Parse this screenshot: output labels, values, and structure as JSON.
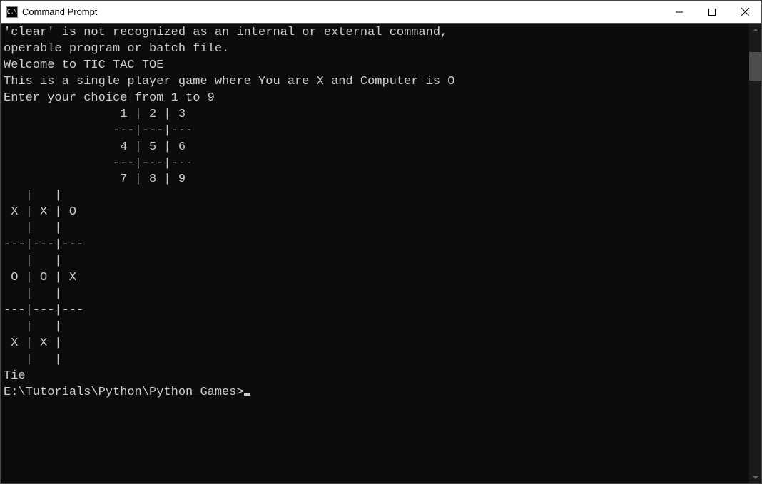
{
  "window": {
    "title": "Command Prompt",
    "icon_label": "C:\\"
  },
  "terminal": {
    "lines": {
      "l0": "'clear' is not recognized as an internal or external command,",
      "l1": "operable program or batch file.",
      "l2": "Welcome to TIC TAC TOE",
      "l3": "This is a single player game where You are X and Computer is O",
      "l4": "Enter your choice from 1 to 9",
      "l5": "",
      "l6": "                1 | 2 | 3",
      "l7": "               ---|---|---",
      "l8": "                4 | 5 | 6",
      "l9": "               ---|---|---",
      "l10": "                7 | 8 | 9",
      "l11": "",
      "l12": "   |   |",
      "l13": " X | X | O",
      "l14": "   |   |",
      "l15": "---|---|---",
      "l16": "   |   |",
      "l17": " O | O | X",
      "l18": "   |   |",
      "l19": "---|---|---",
      "l20": "   |   |",
      "l21": " X | X |",
      "l22": "   |   |",
      "l23": "Tie",
      "l24": "",
      "prompt": "E:\\Tutorials\\Python\\Python_Games>"
    }
  },
  "game_state": {
    "reference_grid": [
      "1",
      "2",
      "3",
      "4",
      "5",
      "6",
      "7",
      "8",
      "9"
    ],
    "board": [
      "X",
      "X",
      "O",
      "O",
      "O",
      "X",
      "X",
      "X",
      " "
    ],
    "result": "Tie",
    "player_symbol": "X",
    "computer_symbol": "O"
  }
}
